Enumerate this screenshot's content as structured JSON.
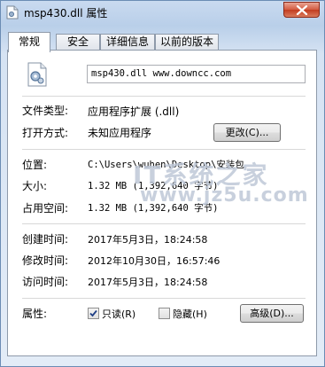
{
  "window": {
    "title": "msp430.dll 属性",
    "close_icon": "close-icon",
    "file_icon": "dll-gear-icon"
  },
  "tabs": [
    {
      "label": "常规",
      "active": true
    },
    {
      "label": "安全",
      "active": false
    },
    {
      "label": "详细信息",
      "active": false
    },
    {
      "label": "以前的版本",
      "active": false
    }
  ],
  "general": {
    "file_name": "msp430.dll www.downcc.com",
    "type_label": "文件类型:",
    "type_value": "应用程序扩展 (.dll)",
    "opens_with_label": "打开方式:",
    "opens_with_value": "未知应用程序",
    "change_button": "更改(C)...",
    "location_label": "位置:",
    "location_value": "C:\\Users\\wuhen\\Desktop\\安装包",
    "size_label": "大小:",
    "size_value": "1.32 MB (1,392,640 字节)",
    "size_on_disk_label": "占用空间:",
    "size_on_disk_value": "1.32 MB (1,392,640 字节)",
    "created_label": "创建时间:",
    "created_value": "2017年5月3日，18:24:58",
    "modified_label": "修改时间:",
    "modified_value": "2012年10月30日，16:57:46",
    "accessed_label": "访问时间:",
    "accessed_value": "2017年5月3日，18:24:58",
    "attributes_label": "属性:",
    "readonly_label": "只读(R)",
    "readonly_checked": true,
    "hidden_label": "隐藏(H)",
    "hidden_checked": false,
    "advanced_button": "高级(D)..."
  },
  "watermark": {
    "line1": "IT系统之家",
    "line2": "www.jz5u.com"
  }
}
